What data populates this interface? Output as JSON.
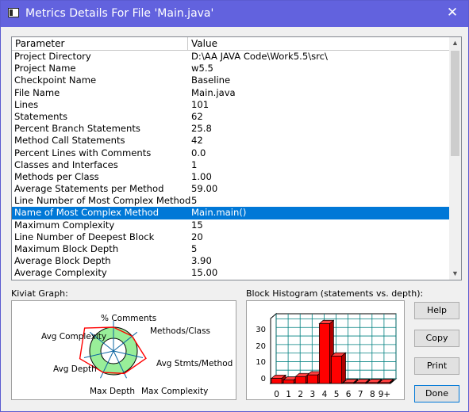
{
  "window": {
    "title": "Metrics Details For File 'Main.java'",
    "close_glyph": "✕",
    "accent": "#6262de"
  },
  "table": {
    "columns": [
      "Parameter",
      "Value"
    ],
    "selected_index": 13,
    "rows": [
      {
        "param": "Project Directory",
        "value": "D:\\AA JAVA Code\\Work5.5\\src\\"
      },
      {
        "param": "Project Name",
        "value": "w5.5"
      },
      {
        "param": "Checkpoint Name",
        "value": "Baseline"
      },
      {
        "param": "File Name",
        "value": "Main.java"
      },
      {
        "param": "Lines",
        "value": "101"
      },
      {
        "param": "Statements",
        "value": "62"
      },
      {
        "param": "Percent Branch Statements",
        "value": "25.8"
      },
      {
        "param": "Method Call Statements",
        "value": "42"
      },
      {
        "param": "Percent Lines with Comments",
        "value": "0.0"
      },
      {
        "param": "Classes and Interfaces",
        "value": "1"
      },
      {
        "param": "Methods per Class",
        "value": "1.00"
      },
      {
        "param": "Average Statements per Method",
        "value": "59.00"
      },
      {
        "param": "Line Number of Most Complex Method",
        "value": "5"
      },
      {
        "param": "Name of Most Complex Method",
        "value": "Main.main()"
      },
      {
        "param": "Maximum Complexity",
        "value": "15"
      },
      {
        "param": "Line Number of Deepest Block",
        "value": "20"
      },
      {
        "param": "Maximum Block Depth",
        "value": "5"
      },
      {
        "param": "Average Block Depth",
        "value": "3.90"
      },
      {
        "param": "Average Complexity",
        "value": "15.00"
      }
    ]
  },
  "kiviat": {
    "label": "Kiviat Graph:",
    "axes": [
      "% Comments",
      "Methods/Class",
      "Avg Stmts/Method",
      "Max Complexity",
      "Max Depth",
      "Avg Depth",
      "Avg Complexity"
    ]
  },
  "histogram": {
    "label": "Block Histogram (statements vs. depth):",
    "y_ticks": [
      "30",
      "20",
      "10",
      "0"
    ],
    "categories": [
      "0",
      "1",
      "2",
      "3",
      "4",
      "5",
      "6",
      "7",
      "8",
      "9+"
    ],
    "values": [
      3,
      2,
      4,
      5,
      35,
      16,
      0,
      0,
      0,
      0
    ],
    "ymax": 38,
    "bar_color": "#ff0000"
  },
  "buttons": {
    "help": "Help",
    "copy": "Copy",
    "print": "Print",
    "done": "Done"
  }
}
